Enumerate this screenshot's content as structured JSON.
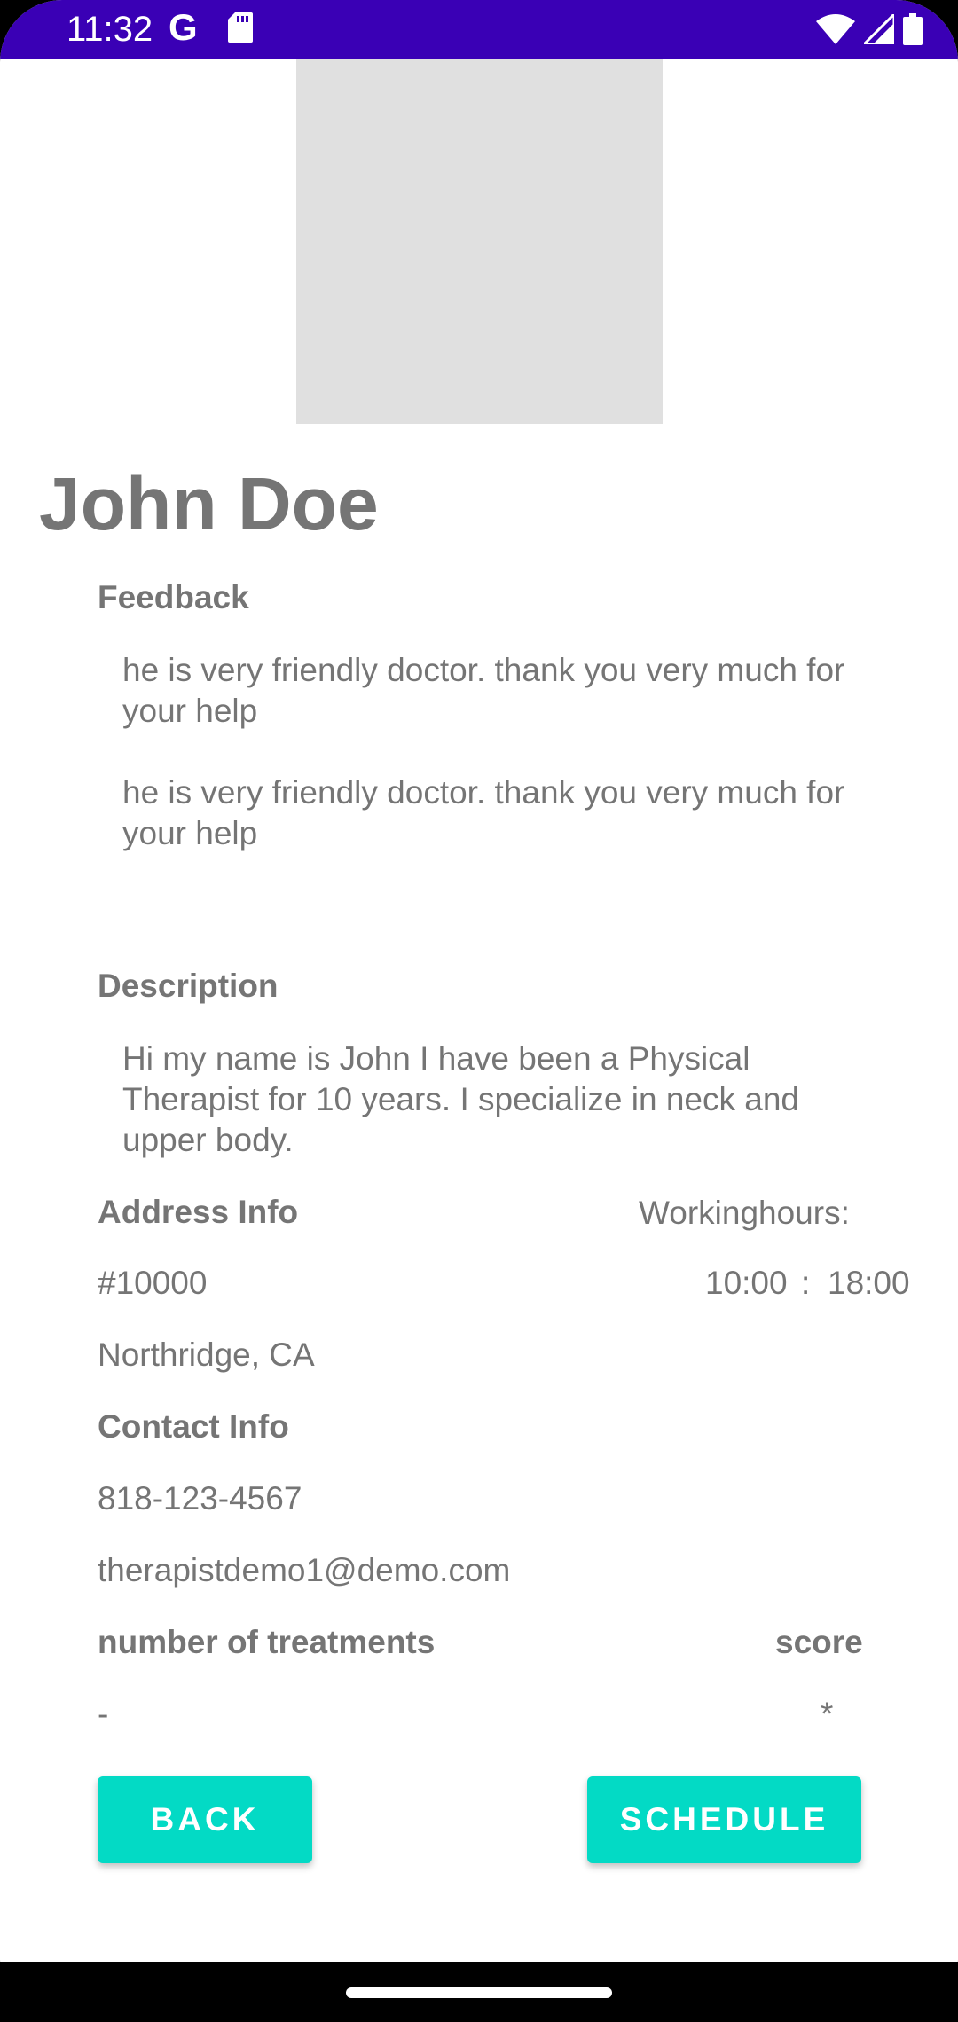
{
  "status_bar": {
    "time": "11:32",
    "g_label": "G",
    "icons": [
      "g-icon",
      "sd-card-icon",
      "wifi-icon",
      "signal-icon",
      "battery-icon"
    ],
    "background": "#3A00B5"
  },
  "profile": {
    "name": "John Doe"
  },
  "feedback": {
    "label": "Feedback",
    "items": [
      "he is very friendly doctor. thank you very much for your help",
      "he is very friendly doctor. thank you very much for your help"
    ]
  },
  "description": {
    "label": "Description",
    "text": "Hi my name is John I have been a Physical Therapist for 10 years. I specialize in neck and upper body."
  },
  "address": {
    "label": "Address Info",
    "line1": "#10000",
    "line2": "Northridge, CA"
  },
  "working_hours": {
    "label": "Workinghours:",
    "start": "10:00",
    "separator": ":",
    "end": "18:00"
  },
  "contact": {
    "label": "Contact Info",
    "phone": "818-123-4567",
    "email": "therapistdemo1@demo.com"
  },
  "stats": {
    "treatments_label": "number of treatments",
    "treatments_value": "-",
    "score_label": "score",
    "score_value": "*"
  },
  "buttons": {
    "back": "BACK",
    "schedule": "SCHEDULE"
  },
  "colors": {
    "accent": "#03DAC5",
    "text": "#757575",
    "placeholder": "#E0E0E0"
  }
}
